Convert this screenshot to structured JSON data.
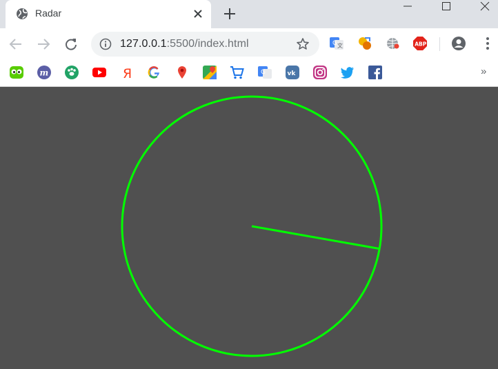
{
  "tab": {
    "title": "Radar"
  },
  "omnibox": {
    "url_host": "127.0.0.1",
    "url_rest": ":5500/index.html"
  },
  "bookmarks": {
    "more_label": "»",
    "items": [
      "duolingo-icon",
      "m-icon",
      "paw-icon",
      "youtube-icon",
      "yandex-icon",
      "google-icon",
      "maps-pin-icon",
      "google-maps-icon",
      "cart-icon",
      "translate-icon",
      "vk-icon",
      "instagram-icon",
      "twitter-icon",
      "facebook-icon"
    ]
  },
  "extensions": [
    "google-translate-icon",
    "overlay-icon",
    "globe-extension-icon",
    "adblock-plus-icon"
  ],
  "colors": {
    "radar": "#00ff00",
    "background": "#505050"
  },
  "radar": {
    "sweep_angle_degrees": 10
  }
}
